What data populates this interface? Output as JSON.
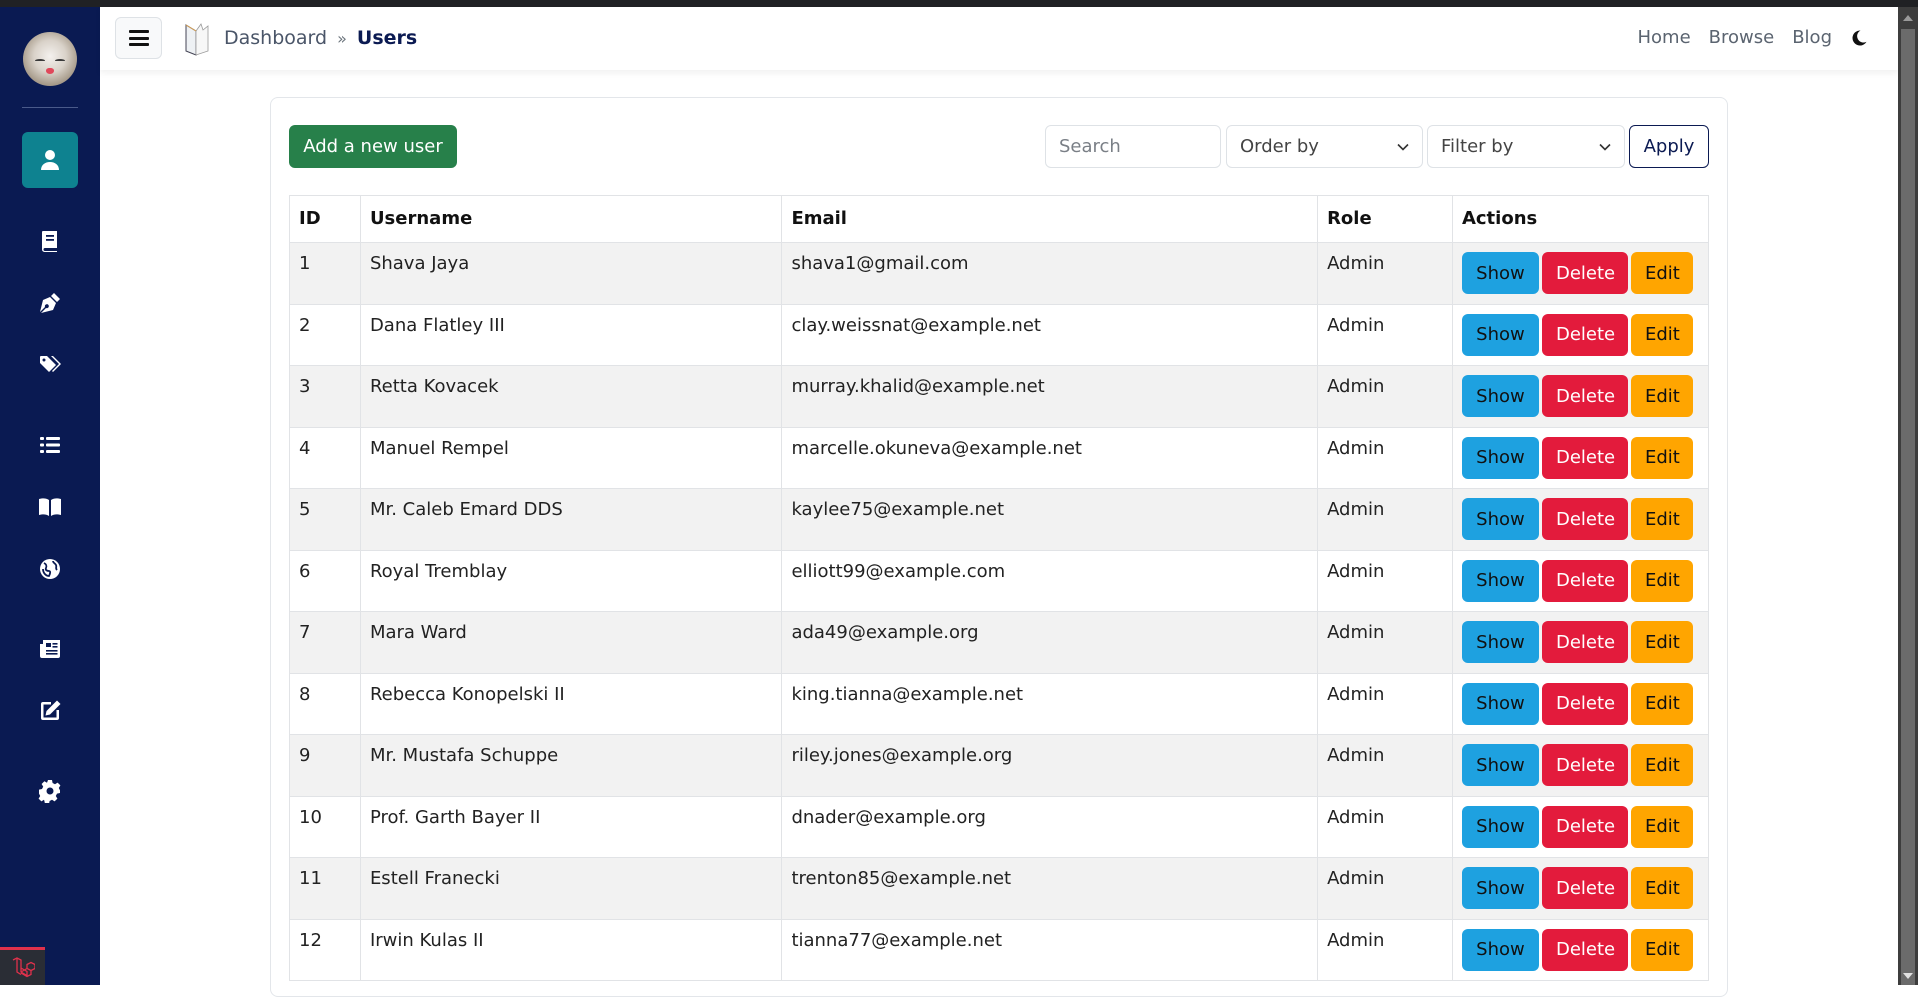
{
  "header": {
    "breadcrumb": [
      "Dashboard",
      "Users"
    ],
    "breadcrumb_separator": "»",
    "nav_links": [
      "Home",
      "Browse",
      "Blog"
    ]
  },
  "sidebar": {
    "items": [
      {
        "icon": "user-icon",
        "active": true
      },
      {
        "icon": "book-icon",
        "active": false
      },
      {
        "icon": "pen-nib-icon",
        "active": false
      },
      {
        "icon": "tags-icon",
        "active": false
      },
      {
        "icon": "list-icon",
        "active": false
      },
      {
        "icon": "open-book-icon",
        "active": false
      },
      {
        "icon": "globe-icon",
        "active": false
      },
      {
        "icon": "newspaper-icon",
        "active": false
      },
      {
        "icon": "edit-icon",
        "active": false
      },
      {
        "icon": "gear-icon",
        "active": false
      }
    ]
  },
  "toolbar": {
    "add_label": "Add a new user",
    "search_placeholder": "Search",
    "order_by": "Order by",
    "filter_by": "Filter by",
    "apply_label": "Apply"
  },
  "table": {
    "columns": [
      "ID",
      "Username",
      "Email",
      "Role",
      "Actions"
    ],
    "action_labels": {
      "show": "Show",
      "delete": "Delete",
      "edit": "Edit"
    },
    "rows": [
      {
        "id": "1",
        "username": "Shava Jaya",
        "email": "shava1@gmail.com",
        "role": "Admin"
      },
      {
        "id": "2",
        "username": "Dana Flatley III",
        "email": "clay.weissnat@example.net",
        "role": "Admin"
      },
      {
        "id": "3",
        "username": "Retta Kovacek",
        "email": "murray.khalid@example.net",
        "role": "Admin"
      },
      {
        "id": "4",
        "username": "Manuel Rempel",
        "email": "marcelle.okuneva@example.net",
        "role": "Admin"
      },
      {
        "id": "5",
        "username": "Mr. Caleb Emard DDS",
        "email": "kaylee75@example.net",
        "role": "Admin"
      },
      {
        "id": "6",
        "username": "Royal Tremblay",
        "email": "elliott99@example.com",
        "role": "Admin"
      },
      {
        "id": "7",
        "username": "Mara Ward",
        "email": "ada49@example.org",
        "role": "Admin"
      },
      {
        "id": "8",
        "username": "Rebecca Konopelski II",
        "email": "king.tianna@example.net",
        "role": "Admin"
      },
      {
        "id": "9",
        "username": "Mr. Mustafa Schuppe",
        "email": "riley.jones@example.org",
        "role": "Admin"
      },
      {
        "id": "10",
        "username": "Prof. Garth Bayer II",
        "email": "dnader@example.org",
        "role": "Admin"
      },
      {
        "id": "11",
        "username": "Estell Franecki",
        "email": "trenton85@example.net",
        "role": "Admin"
      },
      {
        "id": "12",
        "username": "Irwin Kulas II",
        "email": "tianna77@example.net",
        "role": "Admin"
      }
    ]
  },
  "colors": {
    "sidebar_bg": "#0a1a52",
    "sidebar_active": "#0e8290",
    "add_button": "#27804a",
    "show_button": "#1ea1e0",
    "delete_button": "#e31b3c",
    "edit_button": "#ffa500",
    "apply_border": "#0b1a52"
  }
}
